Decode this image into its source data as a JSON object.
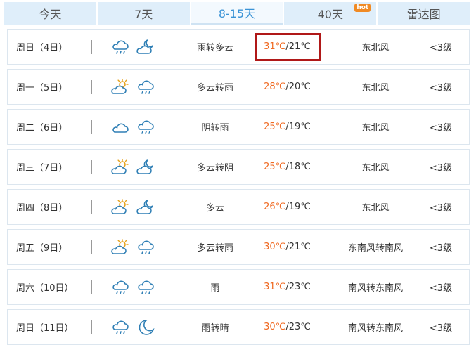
{
  "tabs": [
    {
      "label": "今天"
    },
    {
      "label": "7天"
    },
    {
      "label": "8-15天",
      "active": true
    },
    {
      "label": "40天",
      "badge": "hot"
    },
    {
      "label": "雷达图"
    }
  ],
  "accent_colors": {
    "high_temp": "#f06a22",
    "active_tab": "#3a93d6",
    "highlight_box": "#b01818",
    "icon_stroke": "#2f7fb5"
  },
  "days": [
    {
      "day": "周日（4日）",
      "icon_day": "cloud-rain-icon",
      "icon_night": "moon-cloud-icon",
      "desc": "雨转多云",
      "high": "31℃",
      "low": "/21℃",
      "wind": "东北风",
      "level": "<3级"
    },
    {
      "day": "周一（5日）",
      "icon_day": "sun-cloud-icon",
      "icon_night": "cloud-rain-icon",
      "desc": "多云转雨",
      "high": "28℃",
      "low": "/20℃",
      "wind": "东北风",
      "level": "<3级"
    },
    {
      "day": "周二（6日）",
      "icon_day": "cloud-icon",
      "icon_night": "cloud-rain-icon",
      "desc": "阴转雨",
      "high": "25℃",
      "low": "/19℃",
      "wind": "东北风",
      "level": "<3级"
    },
    {
      "day": "周三（7日）",
      "icon_day": "sun-cloud-icon",
      "icon_night": "moon-cloud-icon",
      "desc": "多云转阴",
      "high": "25℃",
      "low": "/18℃",
      "wind": "东北风",
      "level": "<3级"
    },
    {
      "day": "周四（8日）",
      "icon_day": "sun-cloud-icon",
      "icon_night": "moon-cloud-icon",
      "desc": "多云",
      "high": "26℃",
      "low": "/19℃",
      "wind": "东北风",
      "level": "<3级"
    },
    {
      "day": "周五（9日）",
      "icon_day": "sun-cloud-icon",
      "icon_night": "cloud-rain-icon",
      "desc": "多云转雨",
      "high": "30℃",
      "low": "/21℃",
      "wind": "东南风转南风",
      "level": "<3级"
    },
    {
      "day": "周六（10日）",
      "icon_day": "cloud-rain-icon",
      "icon_night": "cloud-rain-icon",
      "desc": "雨",
      "high": "31℃",
      "low": "/23℃",
      "wind": "南风转东南风",
      "level": "<3级"
    },
    {
      "day": "周日（11日）",
      "icon_day": "cloud-rain-icon",
      "icon_night": "moon-icon",
      "desc": "雨转晴",
      "high": "30℃",
      "low": "/23℃",
      "wind": "南风转东南风",
      "level": "<3级"
    }
  ]
}
